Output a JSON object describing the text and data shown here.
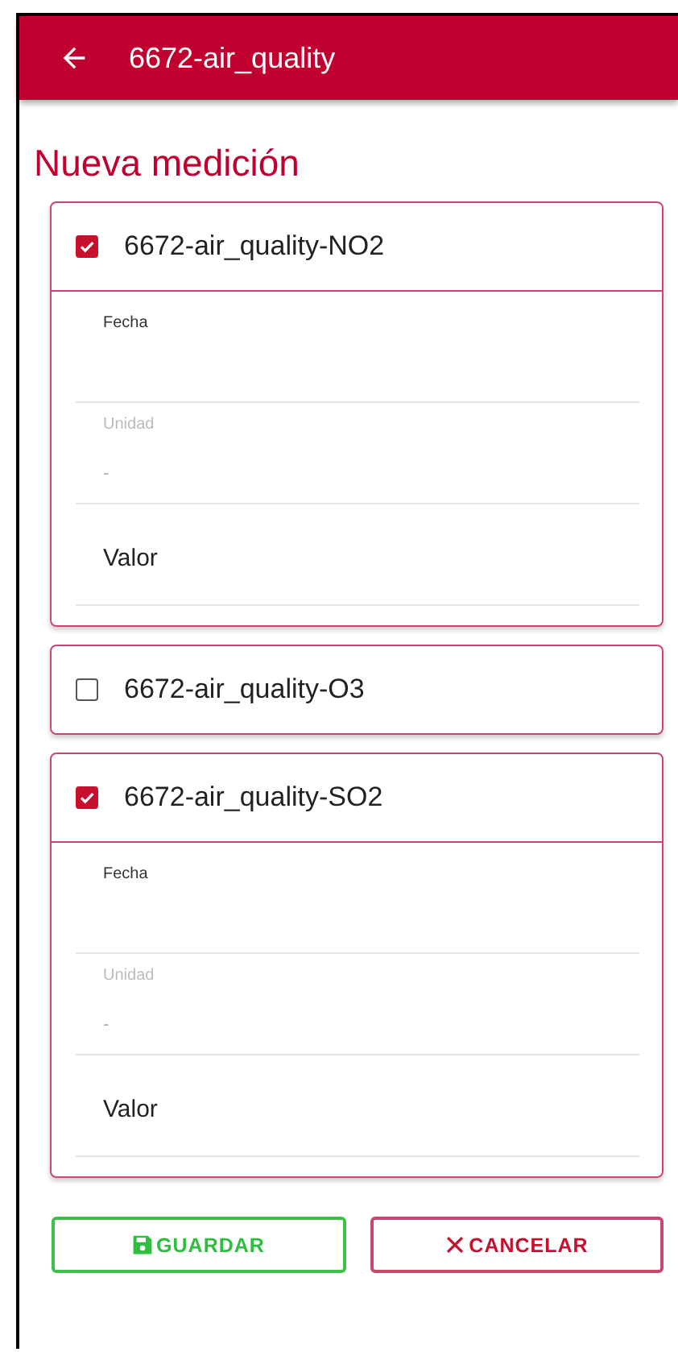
{
  "app_bar": {
    "title": "6672-air_quality"
  },
  "heading": "Nueva medición",
  "measurements": [
    {
      "name": "6672-air_quality-NO2",
      "checked": true,
      "fields": [
        {
          "label": "Fecha",
          "disabled": false
        },
        {
          "label": "Unidad",
          "value": "-",
          "disabled": true
        },
        {
          "placeholder": "Valor",
          "disabled": false
        }
      ]
    },
    {
      "name": "6672-air_quality-O3",
      "checked": false
    },
    {
      "name": "6672-air_quality-SO2",
      "checked": true,
      "fields": [
        {
          "label": "Fecha",
          "disabled": false
        },
        {
          "label": "Unidad",
          "value": "-",
          "disabled": true
        },
        {
          "placeholder": "Valor",
          "disabled": false
        }
      ]
    }
  ],
  "buttons": [
    {
      "kind": "save",
      "label": "GUARDAR"
    },
    {
      "kind": "cancel",
      "label": "CANCELAR"
    }
  ]
}
